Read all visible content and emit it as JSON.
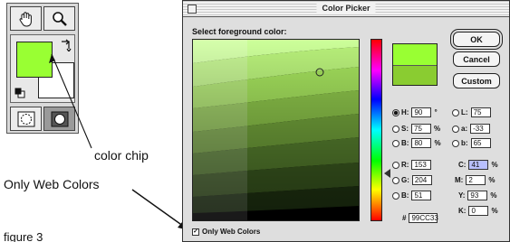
{
  "annotations": {
    "color_chip": "color chip",
    "only_web_colors": "Only Web Colors",
    "figure": "figure 3"
  },
  "toolbox": {
    "tools_top": [
      "hand-tool-icon",
      "zoom-tool-icon"
    ],
    "tools_bottom": [
      "standard-mode-icon",
      "quick-mask-icon"
    ],
    "foreground_color": "#99ff33",
    "background_color": "#ffffff"
  },
  "picker": {
    "title": "Color Picker",
    "prompt": "Select foreground color:",
    "buttons": {
      "ok": "OK",
      "cancel": "Cancel",
      "custom": "Custom"
    },
    "new_color": "#99ff33",
    "current_color": "#8acc31",
    "hsb": [
      {
        "label": "H:",
        "value": "90",
        "unit": "°",
        "selected": true
      },
      {
        "label": "S:",
        "value": "75",
        "unit": "%",
        "selected": false
      },
      {
        "label": "B:",
        "value": "80",
        "unit": "%",
        "selected": false
      }
    ],
    "rgb": [
      {
        "label": "R:",
        "value": "153"
      },
      {
        "label": "G:",
        "value": "204"
      },
      {
        "label": "B:",
        "value": "51"
      }
    ],
    "lab": [
      {
        "label": "L:",
        "value": "75"
      },
      {
        "label": "a:",
        "value": "-33"
      },
      {
        "label": "b:",
        "value": "65"
      }
    ],
    "cmyk": [
      {
        "label": "C:",
        "value": "41",
        "unit": "%"
      },
      {
        "label": "M:",
        "value": "2",
        "unit": "%"
      },
      {
        "label": "Y:",
        "value": "93",
        "unit": "%"
      },
      {
        "label": "K:",
        "value": "0",
        "unit": "%"
      }
    ],
    "hex_label": "#",
    "hex_value": "99CC33",
    "only_web_colors_label": "Only Web Colors",
    "only_web_colors_checked": true
  }
}
